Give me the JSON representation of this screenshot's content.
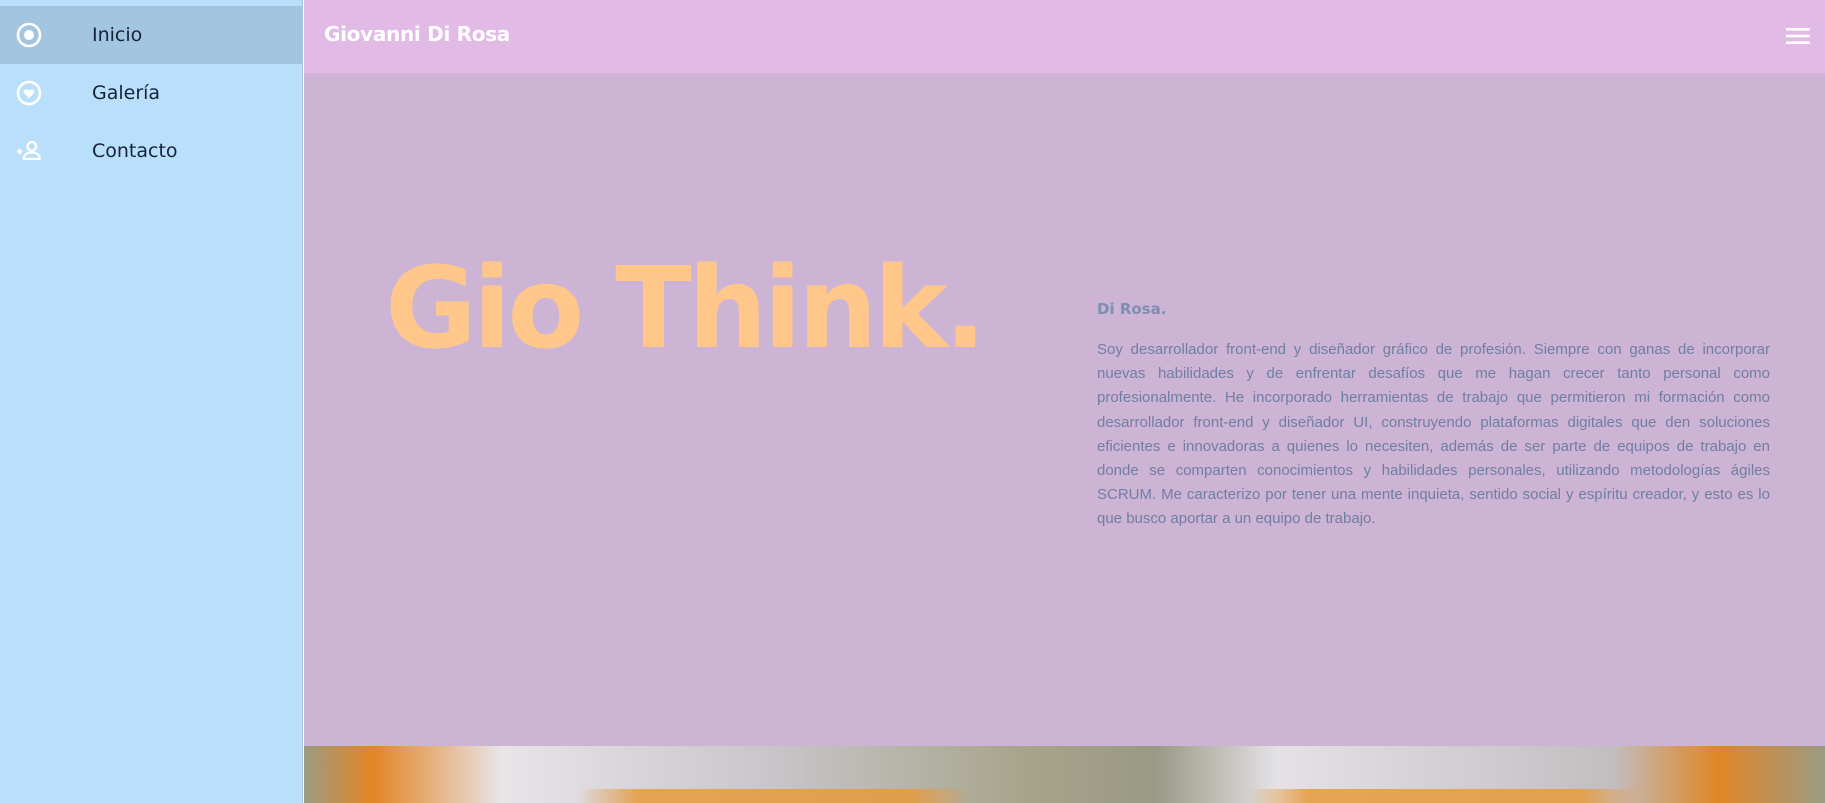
{
  "sidebar": {
    "items": [
      {
        "label": "Inicio",
        "icon": "radio-button-checked-icon",
        "active": true
      },
      {
        "label": "Galería",
        "icon": "heart-circle-icon",
        "active": false
      },
      {
        "label": "Contacto",
        "icon": "person-add-icon",
        "active": false
      }
    ]
  },
  "header": {
    "title": "Giovanni Di Rosa",
    "menu_icon": "menu-icon"
  },
  "hero": {
    "title": "Gio Think."
  },
  "about": {
    "heading": "Di Rosa.",
    "text": "Soy desarrollador front-end y diseñador gráfico de profesión. Siempre con ganas de incorporar nuevas habilidades y de enfrentar desafíos que me hagan crecer tanto personal como profesionalmente. He incorporado herramientas de trabajo que permitieron mi formación como desarrollador front-end y diseñador UI, construyendo plataformas digitales que den soluciones eficientes e innovadoras a quienes lo necesiten, además de ser parte de equipos de trabajo en donde se comparten conocimientos y habilidades personales, utilizando metodologías ágiles SCRUM. Me caracterizo por tener una mente inquieta, sentido social y espíritu creador, y esto es lo que busco aportar a un equipo de trabajo."
  },
  "colors": {
    "sidebar_bg": "#b9dffa",
    "sidebar_active": "#a3c5e0",
    "appbar_bg": "#e1bae6",
    "main_bg": "#cdb3d4",
    "hero_title": "#ffc88a",
    "about_text": "#6f7fa3"
  }
}
